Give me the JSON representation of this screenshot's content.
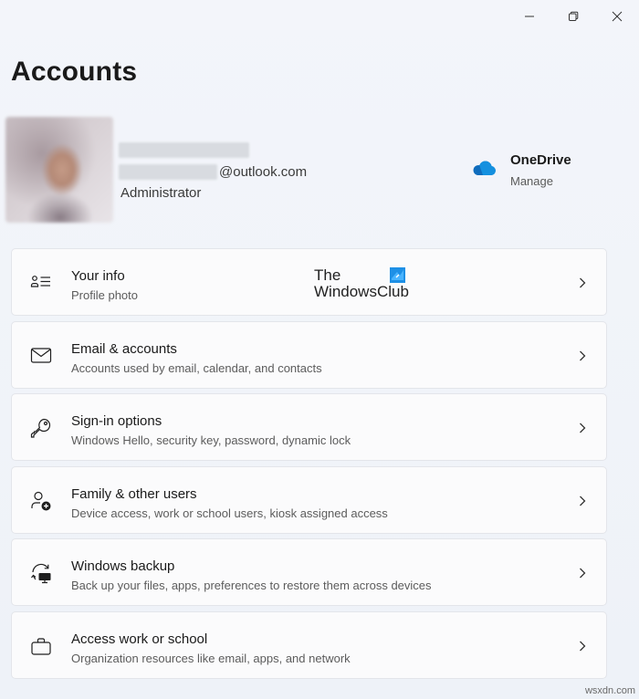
{
  "window": {
    "controls": {
      "minimize_icon": "minimize-icon",
      "restore_icon": "restore-icon",
      "close_icon": "close-icon"
    }
  },
  "page": {
    "title": "Accounts"
  },
  "profile": {
    "email_suffix": "@outlook.com",
    "role": "Administrator"
  },
  "onedrive": {
    "title": "OneDrive",
    "action": "Manage",
    "icon": "onedrive-cloud-icon",
    "color": "#0f6cbd"
  },
  "settings": [
    {
      "title": "Your info",
      "subtitle": "Profile photo",
      "icon": "person-card-icon"
    },
    {
      "title": "Email & accounts",
      "subtitle": "Accounts used by email, calendar, and contacts",
      "icon": "mail-icon"
    },
    {
      "title": "Sign-in options",
      "subtitle": "Windows Hello, security key, password, dynamic lock",
      "icon": "key-icon"
    },
    {
      "title": "Family & other users",
      "subtitle": "Device access, work or school users, kiosk assigned access",
      "icon": "person-add-icon"
    },
    {
      "title": "Windows backup",
      "subtitle": "Back up your files, apps, preferences to restore them across devices",
      "icon": "backup-icon"
    },
    {
      "title": "Access work or school",
      "subtitle": "Organization resources like email, apps, and network",
      "icon": "briefcase-icon"
    }
  ],
  "watermark": {
    "line1": "The",
    "line2": "WindowsClub"
  },
  "source": "wsxdn.com"
}
